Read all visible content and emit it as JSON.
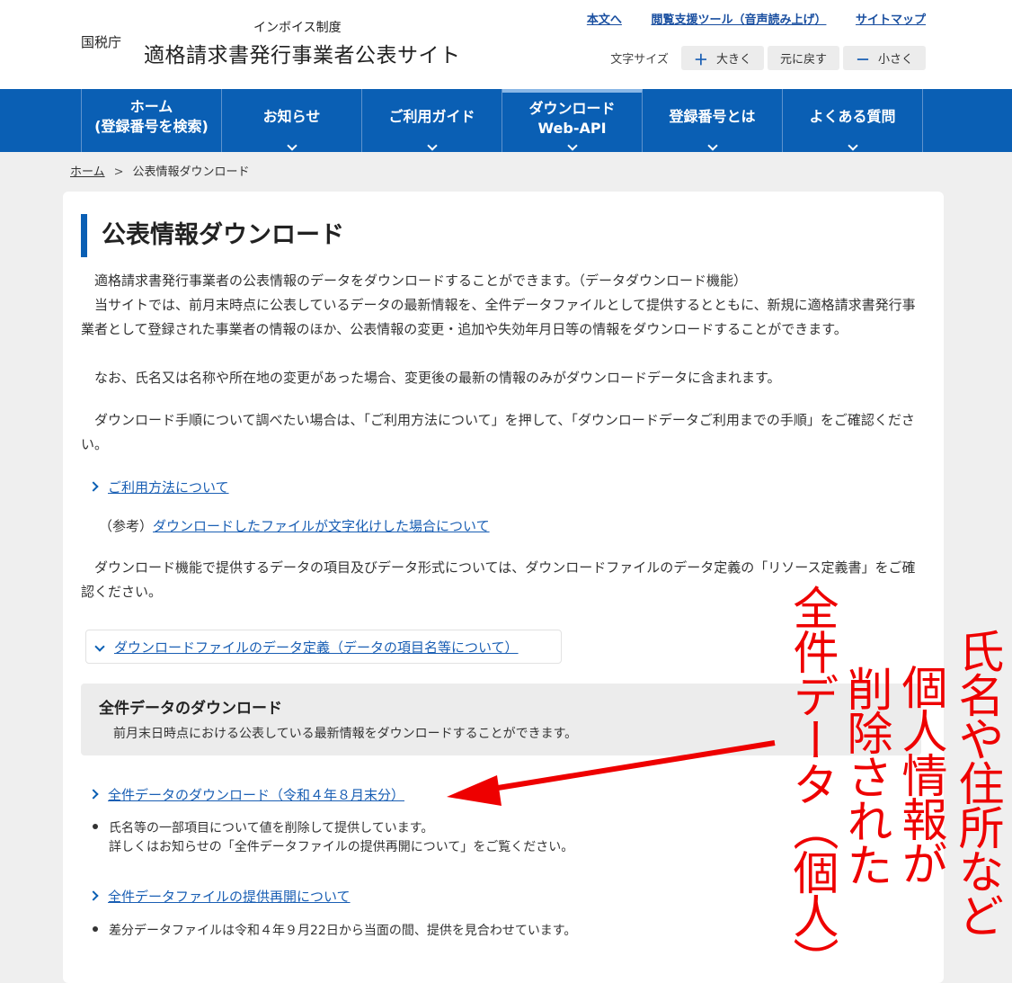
{
  "header": {
    "agency": "国税庁",
    "site_sub": "インボイス制度",
    "site_title": "適格請求書発行事業者公表サイト",
    "util_links": [
      "本文へ",
      "閲覧支援ツール（音声読み上げ）",
      "サイトマップ"
    ],
    "font_size_label": "文字サイズ",
    "font_size_buttons": {
      "larger": "大きく",
      "reset": "元に戻す",
      "smaller": "小さく"
    }
  },
  "nav": {
    "items": [
      {
        "line1": "ホーム",
        "line2": "(登録番号を検索)"
      },
      {
        "line1": "お知らせ",
        "line2": ""
      },
      {
        "line1": "ご利用ガイド",
        "line2": ""
      },
      {
        "line1": "ダウンロード",
        "line2": "Web-API"
      },
      {
        "line1": "登録番号とは",
        "line2": ""
      },
      {
        "line1": "よくある質問",
        "line2": ""
      }
    ],
    "active_index": 3
  },
  "breadcrumb": {
    "home": "ホーム",
    "current": "公表情報ダウンロード"
  },
  "main": {
    "title": "公表情報ダウンロード",
    "intro_1": "適格請求書発行事業者の公表情報のデータをダウンロードすることができます。（データダウンロード機能）",
    "intro_2": "当サイトでは、前月末時点に公表しているデータの最新情報を、全件データファイルとして提供するとともに、新規に適格請求書発行事業者として登録された事業者の情報のほか、公表情報の変更・追加や失効年月日等の情報をダウンロードすることができます。",
    "intro_3": "なお、氏名又は名称や所在地の変更があった場合、変更後の最新の情報のみがダウンロードデータに含まれます。",
    "procedure_text": "ダウンロード手順について調べたい場合は、「ご利用方法について」を押して、「ダウンロードデータご利用までの手順」をご確認ください。",
    "usage_link": "ご利用方法について",
    "ref_prefix": "（参考）",
    "ref_link": "ダウンロードしたファイルが文字化けした場合について",
    "format_text": "ダウンロード機能で提供するデータの項目及びデータ形式については、ダウンロードファイルのデータ定義の「リソース定義書」をご確認ください。",
    "accordion_label": "ダウンロードファイルのデータ定義（データの項目名等について）",
    "full_section": {
      "heading": "全件データのダウンロード",
      "description": "前月末日時点における公表している最新情報をダウンロードすることができます。",
      "download_link": "全件データのダウンロード（令和４年８月末分）",
      "note_line1": "氏名等の一部項目について値を削除して提供しています。",
      "note_line2": "詳しくはお知らせの「全件データファイルの提供再開について」をご覧ください。",
      "resume_link": "全件データファイルの提供再開について",
      "diff_note": "差分データファイルは令和４年９月22日から当面の間、提供を見合わせています。"
    }
  },
  "annotation": {
    "col1": "氏名や住所など",
    "col2": "個人情報が",
    "col3": "削除された",
    "col4": "全件データ（個人）",
    "color": "#ee0000"
  },
  "colors": {
    "nav_blue": "#0a5fb4",
    "link_blue": "#1a5fb4",
    "annotation_red": "#ee0000"
  }
}
